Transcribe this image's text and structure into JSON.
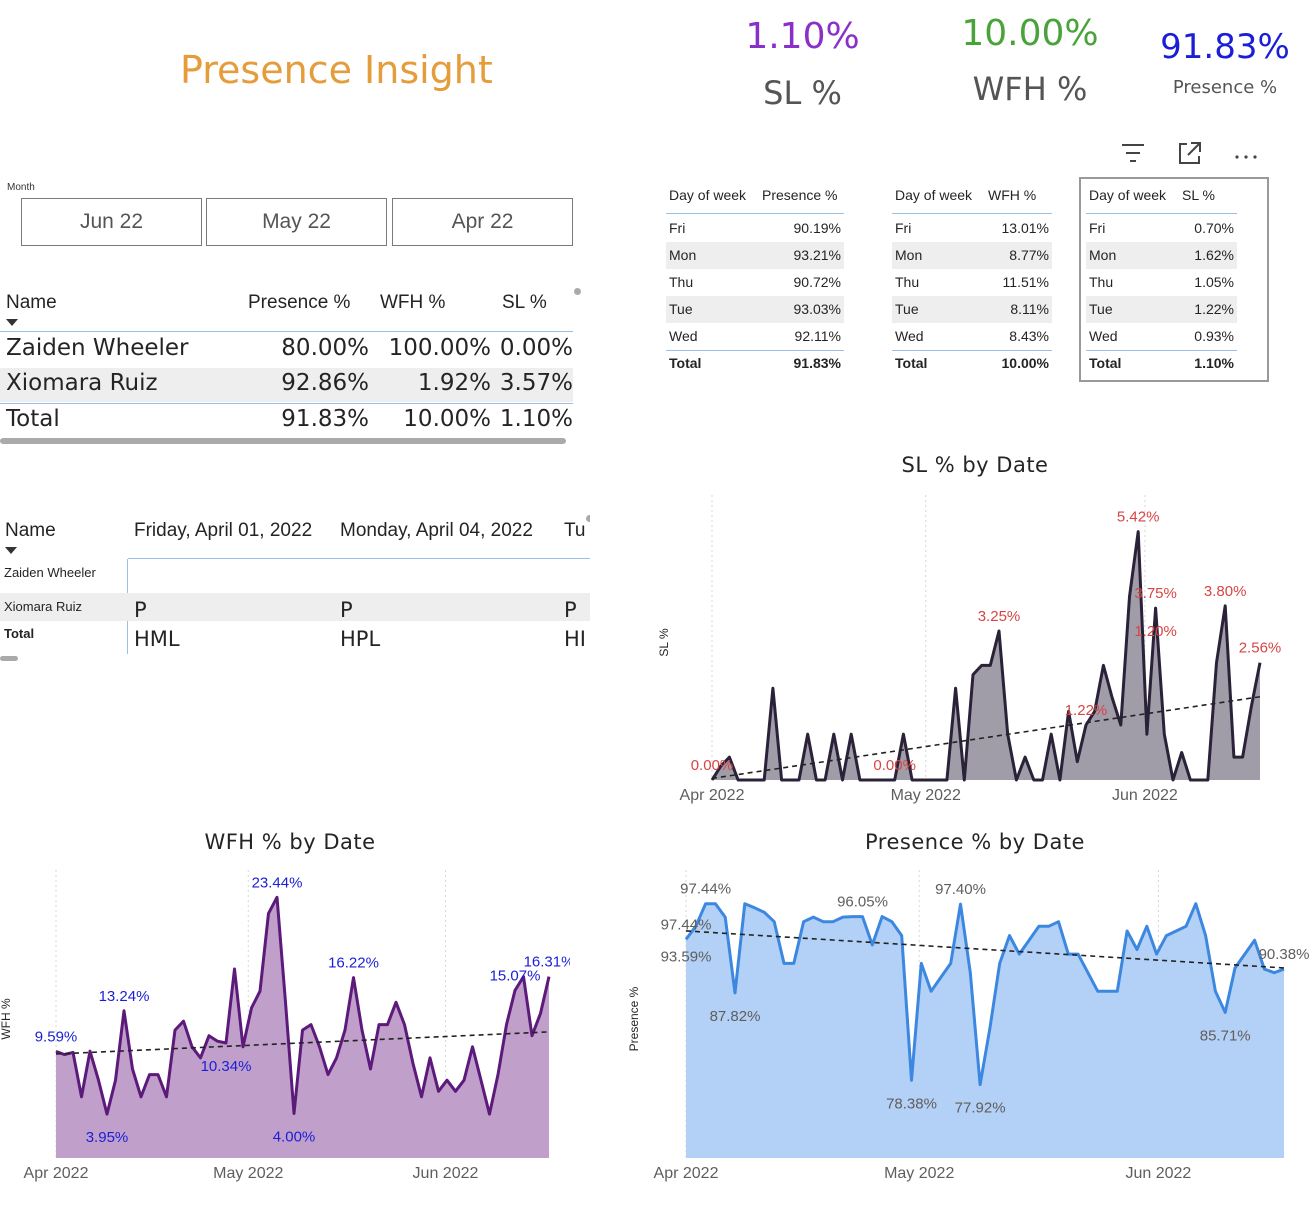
{
  "page_title": "Presence Insight",
  "kpis": {
    "sl": {
      "value": "1.10%",
      "label": "SL %",
      "color": "#8b2fc9"
    },
    "wfh": {
      "value": "10.00%",
      "label": "WFH %",
      "color": "#4aa33a"
    },
    "presence": {
      "value": "91.83%",
      "label": "Presence %",
      "color": "#1a1fd6"
    }
  },
  "slicer": {
    "label": "Month",
    "options": [
      "Jun 22",
      "May 22",
      "Apr 22"
    ]
  },
  "main_table": {
    "headers": [
      "Name",
      "Presence %",
      "WFH %",
      "SL %"
    ],
    "rows": [
      [
        "Zaiden Wheeler",
        "80.00%",
        "100.00%",
        "0.00%"
      ],
      [
        "Xiomara Ruiz",
        "92.86%",
        "1.92%",
        "3.57%"
      ]
    ],
    "total": [
      "Total",
      "91.83%",
      "10.00%",
      "1.10%"
    ]
  },
  "attendance_matrix": {
    "row_header": "Name",
    "columns": [
      "Friday, April 01, 2022",
      "Monday, April 04, 2022",
      "Tu"
    ],
    "rows": [
      {
        "name": "Zaiden Wheeler",
        "cells": [
          "",
          "",
          ""
        ]
      },
      {
        "name": "Xiomara Ruiz",
        "cells": [
          "P",
          "P",
          "P"
        ]
      },
      {
        "name": "Total",
        "cells": [
          "HML",
          "HPL",
          "HI"
        ]
      }
    ]
  },
  "dow_tables": [
    {
      "headers": [
        "Day of week",
        "Presence %"
      ],
      "rows": [
        [
          "Fri",
          "90.19%"
        ],
        [
          "Mon",
          "93.21%"
        ],
        [
          "Thu",
          "90.72%"
        ],
        [
          "Tue",
          "93.03%"
        ],
        [
          "Wed",
          "92.11%"
        ]
      ],
      "total": [
        "Total",
        "91.83%"
      ]
    },
    {
      "headers": [
        "Day of week",
        "WFH %"
      ],
      "rows": [
        [
          "Fri",
          "13.01%"
        ],
        [
          "Mon",
          "8.77%"
        ],
        [
          "Thu",
          "11.51%"
        ],
        [
          "Tue",
          "8.11%"
        ],
        [
          "Wed",
          "8.43%"
        ]
      ],
      "total": [
        "Total",
        "10.00%"
      ]
    },
    {
      "headers": [
        "Day of week",
        "SL %"
      ],
      "rows": [
        [
          "Fri",
          "0.70%"
        ],
        [
          "Mon",
          "1.62%"
        ],
        [
          "Thu",
          "1.05%"
        ],
        [
          "Tue",
          "1.22%"
        ],
        [
          "Wed",
          "0.93%"
        ]
      ],
      "total": [
        "Total",
        "1.10%"
      ]
    }
  ],
  "visual_header_icons": [
    "filter-icon",
    "focus-mode-icon",
    "more-options-icon"
  ],
  "chart_data": [
    {
      "type": "area",
      "title": "SL % by Date",
      "xlabel": "",
      "ylabel": "SL %",
      "x_ticks": [
        "Apr 2022",
        "May 2022",
        "Jun 2022"
      ],
      "ylim": [
        0,
        6
      ],
      "color": "#2a2238",
      "fill": "#a19da8",
      "trendline": true,
      "values": [
        0,
        0.3,
        0.5,
        0,
        0,
        0,
        0,
        2.0,
        0,
        0,
        0,
        1.0,
        0,
        0,
        1.0,
        0,
        1.0,
        0,
        0,
        0,
        0,
        0,
        1.0,
        0,
        0,
        0,
        0,
        0,
        2.0,
        0,
        2.3,
        2.5,
        2.5,
        3.25,
        1.0,
        0,
        0.5,
        0,
        0,
        1.0,
        0,
        1.5,
        0.4,
        1.2,
        1.5,
        2.5,
        1.8,
        1.2,
        4.0,
        5.42,
        1.0,
        3.75,
        1.0,
        0,
        0.6,
        0,
        0,
        0,
        2.56,
        3.8,
        0.5,
        0.5,
        1.6,
        2.56
      ],
      "data_labels": [
        {
          "index": 0,
          "text": "0.00%"
        },
        {
          "index": 21,
          "text": "0.00%"
        },
        {
          "index": 33,
          "text": "3.25%"
        },
        {
          "index": 43,
          "text": "1.22%"
        },
        {
          "index": 49,
          "text": "5.42%"
        },
        {
          "index": 51,
          "text": "3.75%"
        },
        {
          "index": 51,
          "text": "1.20%"
        },
        {
          "index": 59,
          "text": "3.80%"
        },
        {
          "index": 63,
          "text": "2.56%"
        }
      ]
    },
    {
      "type": "area",
      "title": "WFH % by Date",
      "xlabel": "",
      "ylabel": "WFH %",
      "x_ticks": [
        "Apr 2022",
        "May 2022",
        "Jun 2022"
      ],
      "ylim": [
        0,
        25
      ],
      "color": "#5c1a7a",
      "fill": "#c19fcb",
      "trendline": true,
      "values": [
        9.59,
        9.3,
        9.5,
        5.5,
        9.6,
        7.0,
        3.95,
        7.0,
        13.24,
        8.0,
        5.5,
        7.5,
        7.5,
        5.5,
        11.5,
        12.3,
        10.0,
        9.0,
        11.0,
        10.5,
        10.34,
        17.0,
        10.0,
        13.5,
        15.0,
        22.0,
        23.44,
        14.0,
        4.0,
        11.5,
        12.0,
        10.0,
        7.5,
        9.0,
        11.5,
        16.22,
        11.5,
        8.0,
        12.0,
        12.0,
        14.0,
        12.0,
        8.5,
        5.5,
        9.0,
        6.0,
        7.0,
        6.0,
        7.0,
        10.0,
        7.0,
        3.95,
        7.5,
        12.0,
        15.07,
        16.31,
        11.0,
        13.0,
        16.31
      ],
      "data_labels": [
        {
          "index": 0,
          "text": "9.59%"
        },
        {
          "index": 6,
          "text": "3.95%"
        },
        {
          "index": 8,
          "text": "13.24%"
        },
        {
          "index": 20,
          "text": "10.34%"
        },
        {
          "index": 26,
          "text": "23.44%"
        },
        {
          "index": 28,
          "text": "4.00%"
        },
        {
          "index": 35,
          "text": "16.22%"
        },
        {
          "index": 54,
          "text": "15.07%"
        },
        {
          "index": 58,
          "text": "16.31%"
        }
      ]
    },
    {
      "type": "area",
      "title": "Presence % by Date",
      "xlabel": "",
      "ylabel": "Presence %",
      "x_ticks": [
        "Apr 2022",
        "May 2022",
        "Jun 2022"
      ],
      "ylim": [
        70,
        100
      ],
      "color": "#3c87e0",
      "fill": "#b3d0f6",
      "trendline": true,
      "values": [
        93.59,
        95.0,
        97.44,
        97.44,
        96.0,
        87.82,
        97.44,
        97.0,
        96.5,
        95.5,
        91.0,
        91.0,
        95.5,
        96.0,
        95.5,
        95.5,
        96.0,
        96.05,
        96.05,
        93.0,
        96.05,
        95.5,
        94.0,
        78.38,
        91.0,
        88.0,
        89.5,
        91.0,
        97.4,
        90.0,
        77.92,
        84.0,
        91.0,
        94.0,
        92.0,
        93.5,
        95.0,
        95.0,
        95.5,
        92.0,
        92.0,
        90.0,
        88.0,
        88.0,
        88.0,
        94.5,
        92.5,
        95.0,
        92.0,
        94.0,
        94.5,
        95.0,
        97.44,
        94.0,
        88.0,
        85.71,
        90.5,
        92.0,
        93.5,
        90.38,
        90.0,
        90.38
      ],
      "data_labels": [
        {
          "index": 0,
          "text": "97.44%"
        },
        {
          "index": 0,
          "text": "93.59%"
        },
        {
          "index": 2,
          "text": "97.44%"
        },
        {
          "index": 5,
          "text": "87.82%"
        },
        {
          "index": 18,
          "text": "96.05%"
        },
        {
          "index": 23,
          "text": "78.38%"
        },
        {
          "index": 28,
          "text": "97.40%"
        },
        {
          "index": 30,
          "text": "77.92%"
        },
        {
          "index": 55,
          "text": "85.71%"
        },
        {
          "index": 61,
          "text": "90.38%"
        }
      ]
    }
  ]
}
